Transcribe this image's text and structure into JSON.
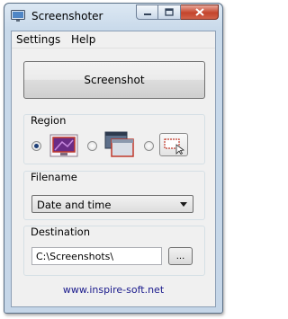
{
  "window": {
    "title": "Screenshoter",
    "icons": {
      "app": "monitor-app-icon",
      "minimize": "minimize-icon",
      "maximize": "maximize-icon",
      "close": "close-icon"
    }
  },
  "menu": {
    "items": [
      "Settings",
      "Help"
    ]
  },
  "main": {
    "screenshot_label": "Screenshot"
  },
  "region": {
    "label": "Region",
    "options": [
      {
        "icon": "fullscreen-icon",
        "selected": true
      },
      {
        "icon": "window-icon",
        "selected": false
      },
      {
        "icon": "selection-area-icon",
        "selected": false
      }
    ]
  },
  "filename": {
    "label": "Filename",
    "selected": "Date and time"
  },
  "destination": {
    "label": "Destination",
    "path": "C:\\Screenshots\\",
    "browse_label": "..."
  },
  "footer": {
    "link": "www.inspire-soft.net"
  },
  "colors": {
    "titlebar": "#c8d9ea",
    "client": "#f0f0f0",
    "close_button": "#c4442c",
    "link": "#1a1a8c"
  }
}
